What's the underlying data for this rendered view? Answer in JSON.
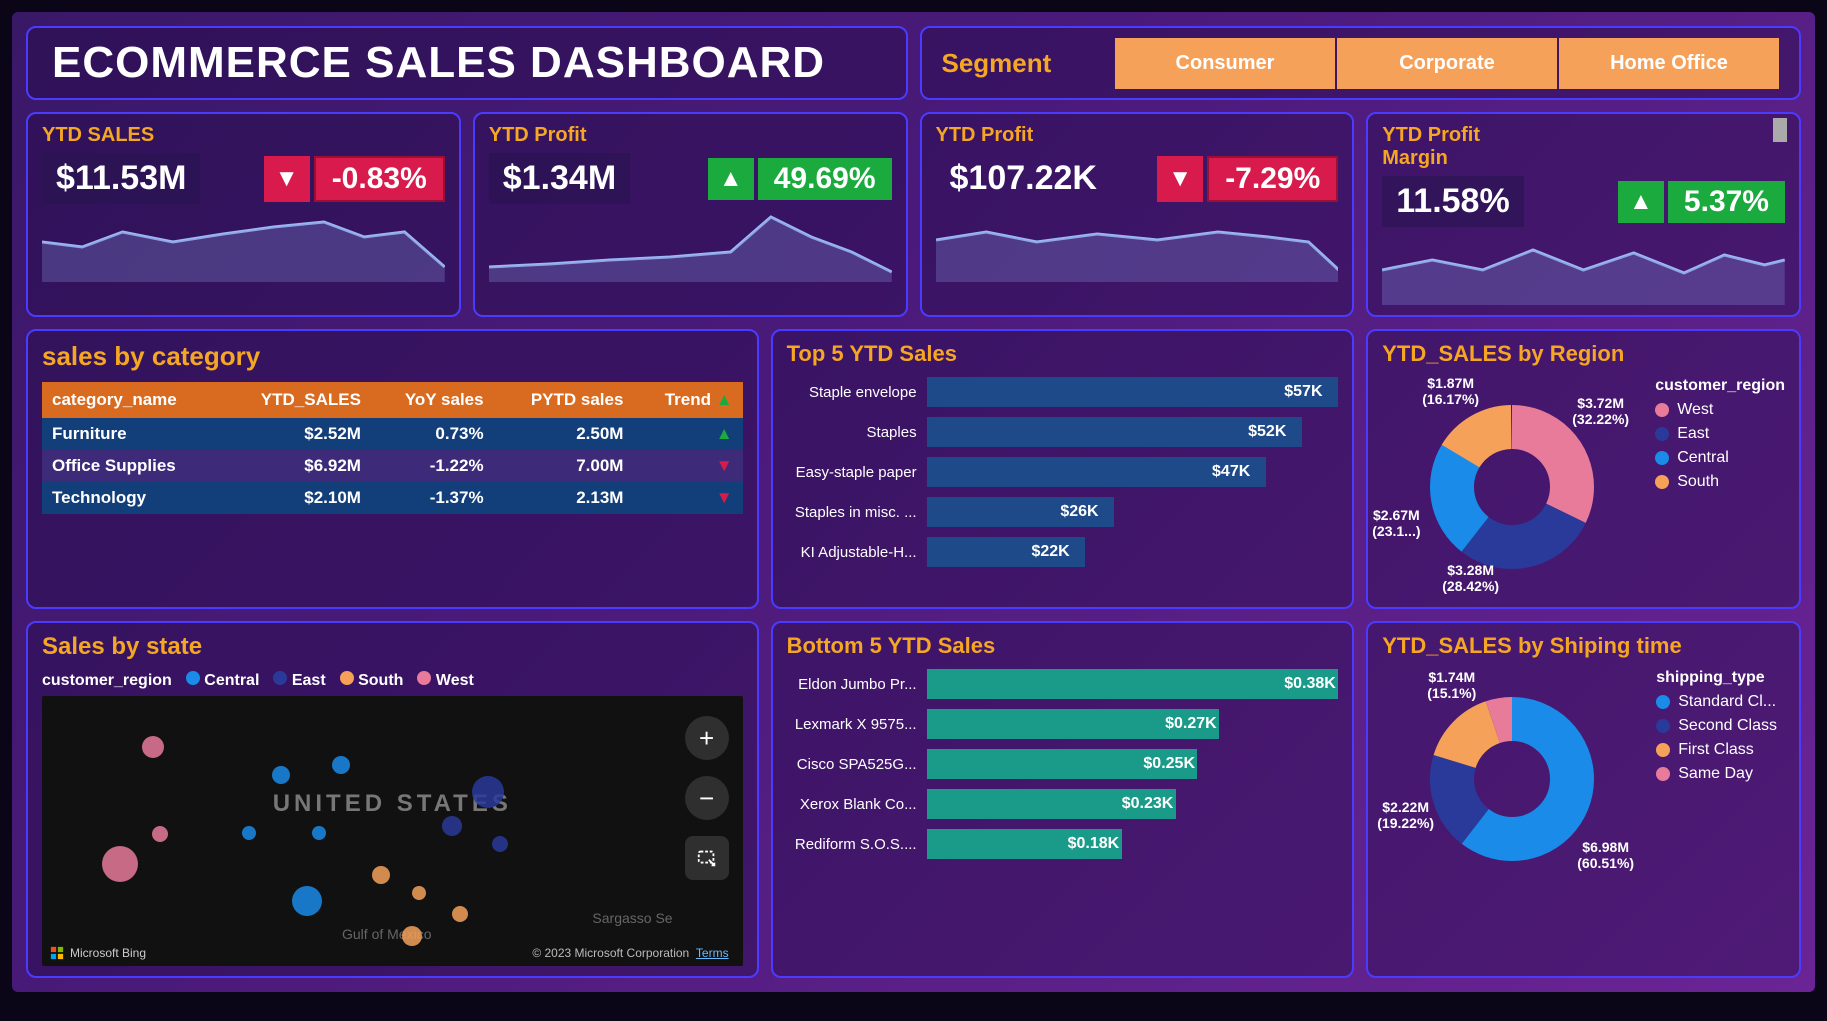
{
  "title": "ECOMMERCE SALES DASHBOARD",
  "segment": {
    "label": "Segment",
    "options": [
      "Consumer",
      "Corporate",
      "Home Office"
    ]
  },
  "kpi": [
    {
      "title": "YTD SALES",
      "value": "$11.53M",
      "delta": "-0.83%",
      "dir": "down"
    },
    {
      "title": "YTD Profit",
      "value": "$1.34M",
      "delta": "49.69%",
      "dir": "up"
    },
    {
      "title": "YTD Profit",
      "value": "$107.22K",
      "delta": "-7.29%",
      "dir": "down"
    },
    {
      "title": "YTD Profit Margin",
      "value": "11.58%",
      "delta": "5.37%",
      "dir": "up"
    }
  ],
  "sales_by_category": {
    "title": "sales by category",
    "columns": [
      "category_name",
      "YTD_SALES",
      "YoY sales",
      "PYTD sales",
      "Trend"
    ],
    "rows": [
      {
        "name": "Furniture",
        "ytd": "$2.52M",
        "yoy": "0.73%",
        "pytd": "2.50M",
        "trend": "up"
      },
      {
        "name": "Office Supplies",
        "ytd": "$6.92M",
        "yoy": "-1.22%",
        "pytd": "7.00M",
        "trend": "down"
      },
      {
        "name": "Technology",
        "ytd": "$2.10M",
        "yoy": "-1.37%",
        "pytd": "2.13M",
        "trend": "down"
      }
    ]
  },
  "top5": {
    "title": "Top 5 YTD Sales",
    "items": [
      {
        "label": "Staple envelope",
        "value_label": "$57K"
      },
      {
        "label": "Staples",
        "value_label": "$52K"
      },
      {
        "label": "Easy-staple paper",
        "value_label": "$47K"
      },
      {
        "label": "Staples in misc. ...",
        "value_label": "$26K"
      },
      {
        "label": "KI Adjustable-H...",
        "value_label": "$22K"
      }
    ]
  },
  "bottom5": {
    "title": "Bottom 5 YTD Sales",
    "items": [
      {
        "label": "Eldon Jumbo Pr...",
        "value_label": "$0.38K"
      },
      {
        "label": "Lexmark X 9575...",
        "value_label": "$0.27K"
      },
      {
        "label": "Cisco SPA525G...",
        "value_label": "$0.25K"
      },
      {
        "label": "Xerox Blank Co...",
        "value_label": "$0.23K"
      },
      {
        "label": "Rediform S.O.S....",
        "value_label": "$0.18K"
      }
    ]
  },
  "region_donut": {
    "title": "YTD_SALES by Region",
    "legend_title": "customer_region",
    "legend": [
      "West",
      "East",
      "Central",
      "South"
    ],
    "labels": {
      "west": {
        "value": "$3.72M",
        "pct": "(32.22%)"
      },
      "east": {
        "value": "$3.28M",
        "pct": "(28.42%)"
      },
      "central": {
        "value": "$2.67M",
        "pct": "(23.1...)"
      },
      "south": {
        "value": "$1.87M",
        "pct": "(16.17%)"
      }
    }
  },
  "ship_donut": {
    "title": "YTD_SALES by Shiping time",
    "legend_title": "shipping_type",
    "legend": [
      "Standard Cl...",
      "Second Class",
      "First Class",
      "Same Day"
    ],
    "labels": {
      "standard": {
        "value": "$6.98M",
        "pct": "(60.51%)"
      },
      "second": {
        "value": "$2.22M",
        "pct": "(19.22%)"
      },
      "first": {
        "value": "$1.74M",
        "pct": "(15.1%)"
      }
    }
  },
  "sales_by_state": {
    "title": "Sales by state",
    "legend_title": "customer_region",
    "legend": [
      "Central",
      "East",
      "South",
      "West"
    ],
    "map_label": "UNITED STATES",
    "gulf_label": "Gulf of Mexico",
    "sargasso_label": "Sargasso Se",
    "bing": "Microsoft Bing",
    "copyright": "© 2023 Microsoft Corporation",
    "terms": "Terms"
  },
  "colors": {
    "west": "#e87a9a",
    "east": "#2a3a9a",
    "central": "#1a8be8",
    "south": "#f5a15a",
    "standard": "#1a8be8",
    "second": "#2a3a9a",
    "first": "#f5a15a",
    "same": "#e87a9a"
  },
  "chart_data": [
    {
      "type": "bar",
      "title": "Top 5 YTD Sales",
      "orientation": "horizontal",
      "categories": [
        "Staple envelope",
        "Staples",
        "Easy-staple paper",
        "Staples in misc.",
        "KI Adjustable-H"
      ],
      "values": [
        57,
        52,
        47,
        26,
        22
      ],
      "unit": "K USD",
      "xlim": [
        0,
        60
      ]
    },
    {
      "type": "bar",
      "title": "Bottom 5 YTD Sales",
      "orientation": "horizontal",
      "categories": [
        "Eldon Jumbo Pr",
        "Lexmark X 9575",
        "Cisco SPA525G",
        "Xerox Blank Co",
        "Rediform S.O.S."
      ],
      "values": [
        0.38,
        0.27,
        0.25,
        0.23,
        0.18
      ],
      "unit": "K USD",
      "xlim": [
        0,
        0.4
      ]
    },
    {
      "type": "pie",
      "title": "YTD_SALES by Region",
      "series": [
        {
          "name": "West",
          "value": 3.72,
          "pct": 32.22
        },
        {
          "name": "East",
          "value": 3.28,
          "pct": 28.42
        },
        {
          "name": "Central",
          "value": 2.67,
          "pct": 23.1
        },
        {
          "name": "South",
          "value": 1.87,
          "pct": 16.17
        }
      ],
      "unit": "M USD",
      "donut": true
    },
    {
      "type": "pie",
      "title": "YTD_SALES by Shiping time",
      "series": [
        {
          "name": "Standard Class",
          "value": 6.98,
          "pct": 60.51
        },
        {
          "name": "Second Class",
          "value": 2.22,
          "pct": 19.22
        },
        {
          "name": "First Class",
          "value": 1.74,
          "pct": 15.1
        },
        {
          "name": "Same Day",
          "value": 0.59,
          "pct": 5.17
        }
      ],
      "unit": "M USD",
      "donut": true
    },
    {
      "type": "table",
      "title": "sales by category",
      "columns": [
        "category_name",
        "YTD_SALES",
        "YoY sales",
        "PYTD sales"
      ],
      "rows": [
        [
          "Furniture",
          2.52,
          0.73,
          2.5
        ],
        [
          "Office Supplies",
          6.92,
          -1.22,
          7.0
        ],
        [
          "Technology",
          2.1,
          -1.37,
          2.13
        ]
      ],
      "units": [
        "",
        "M USD",
        "%",
        "M USD"
      ]
    }
  ]
}
